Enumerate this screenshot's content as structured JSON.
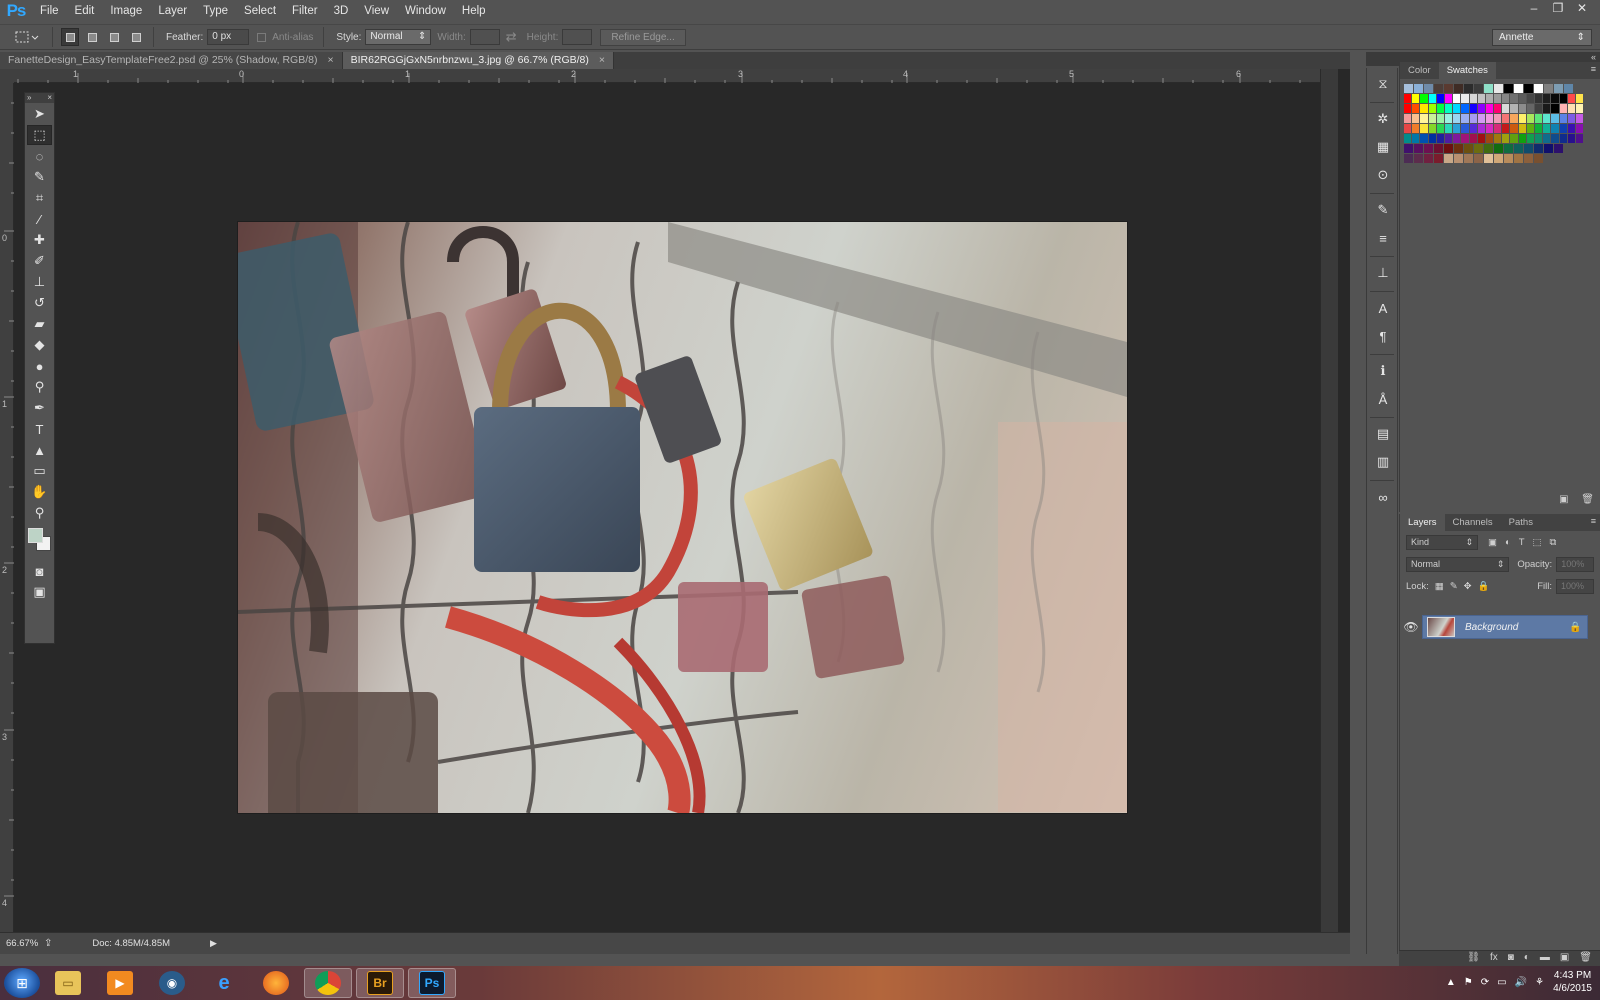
{
  "app": {
    "logo": "Ps"
  },
  "menu": [
    "File",
    "Edit",
    "Image",
    "Layer",
    "Type",
    "Select",
    "Filter",
    "3D",
    "View",
    "Window",
    "Help"
  ],
  "window_controls": {
    "minimize": "–",
    "restore": "❐",
    "close": "✕"
  },
  "options": {
    "feather_label": "Feather:",
    "feather_value": "0 px",
    "antialias_label": "Anti-alias",
    "style_label": "Style:",
    "style_value": "Normal",
    "width_label": "Width:",
    "height_label": "Height:",
    "refine_edge": "Refine Edge...",
    "workspace": "Annette"
  },
  "tabs": [
    {
      "label": "FanetteDesign_EasyTemplateFree2.psd @ 25% (Shadow, RGB/8)",
      "active": false
    },
    {
      "label": "BIR62RGGjGxN5nrbnzwu_3.jpg @ 66.7% (RGB/8)",
      "active": true
    }
  ],
  "ruler": {
    "h_ticks": [
      "0",
      "1",
      "1",
      "2",
      "3",
      "4",
      "5",
      "6"
    ],
    "v_ticks": [
      "0",
      "1",
      "2",
      "3",
      "4"
    ]
  },
  "status": {
    "zoom": "66.67%",
    "doc": "Doc: 4.85M/4.85M"
  },
  "tools": [
    "move-tool-icon",
    "marquee-tool-icon",
    "lasso-tool-icon",
    "quick-selection-tool-icon",
    "crop-tool-icon",
    "eyedropper-tool-icon",
    "healing-brush-tool-icon",
    "brush-tool-icon",
    "clone-stamp-tool-icon",
    "history-brush-tool-icon",
    "eraser-tool-icon",
    "paint-bucket-tool-icon",
    "blur-tool-icon",
    "dodge-tool-icon",
    "pen-tool-icon",
    "type-tool-icon",
    "path-selection-tool-icon",
    "rectangle-tool-icon",
    "hand-tool-icon",
    "zoom-tool-icon"
  ],
  "colors": {
    "foreground": "#bdd3c6",
    "background": "#f2f2f2",
    "accent": "#31a8ff",
    "layer_selected": "#5d79a5"
  },
  "color_panel": {
    "tabs": [
      "Color",
      "Swatches"
    ],
    "active_tab": "Swatches"
  },
  "swatches": [
    [
      "#a6c0dd",
      "#8ab0d8",
      "#6f8ba9",
      "#4c3d38",
      "#5a3a30",
      "#3f2c25",
      "#2c2c2c",
      "#3b3b3b",
      "#8ee0c8",
      "#e8e8e8",
      "#000000",
      "#ffffff",
      "#000000",
      "#ffffff",
      "#808080",
      "#7d9db3",
      "#5f86a8"
    ],
    [
      "#ff0000",
      "#ffff00",
      "#00ff00",
      "#00ffff",
      "#0000ff",
      "#ff00ff",
      "#ffffff",
      "#ebebeb",
      "#d6d6d6",
      "#c2c2c2",
      "#adadad",
      "#999999",
      "#858585",
      "#707070",
      "#5c5c5c",
      "#474747",
      "#333333",
      "#1f1f1f",
      "#0a0a0a",
      "#000000",
      "#ff4b4b",
      "#ffe34b"
    ],
    [
      "#ff0000",
      "#ff4d00",
      "#ffe600",
      "#9dff00",
      "#00ff44",
      "#00ffc3",
      "#00d9ff",
      "#0066ff",
      "#1400ff",
      "#8c00ff",
      "#ff00e1",
      "#ff0070",
      "#d9d9d9",
      "#b3b3b3",
      "#8c8c8c",
      "#666666",
      "#404040",
      "#1a1a1a",
      "#000000",
      "#ffb3b3",
      "#ffe0b3",
      "#fff3b3"
    ],
    [
      "#f59a9a",
      "#f9c08f",
      "#fff59a",
      "#c8f29a",
      "#9af2a6",
      "#9af2e2",
      "#9ad6f2",
      "#9aaef2",
      "#a89af2",
      "#d39af2",
      "#f29ae0",
      "#f29ab8",
      "#f57575",
      "#f7a65c",
      "#fff06a",
      "#a9e65c",
      "#5ce67a",
      "#5ce6cf",
      "#5cbde6",
      "#5c83e6",
      "#7d5ce6",
      "#c45ce6"
    ],
    [
      "#e84646",
      "#ef7c2a",
      "#f9e43a",
      "#84d62a",
      "#2ad654",
      "#2ad6b8",
      "#2aa1d6",
      "#2a5ad6",
      "#552ad6",
      "#a82ad6",
      "#d62ac0",
      "#d62a7a",
      "#c41a1a",
      "#cc5a10",
      "#d1ba10",
      "#5fb010",
      "#10b03a",
      "#10b096",
      "#1082b0",
      "#1040b0",
      "#3a10b0",
      "#8810b0"
    ],
    [
      "#008c8c",
      "#0077a8",
      "#0050b0",
      "#0030a0",
      "#20209c",
      "#501ca0",
      "#80189c",
      "#a01478",
      "#a0104e",
      "#a01010",
      "#a04810",
      "#a07810",
      "#a0a010",
      "#60a010",
      "#10a010",
      "#10a050",
      "#108c6c",
      "#106c8c",
      "#104c8c",
      "#102c8c",
      "#28108c",
      "#50108c"
    ],
    [
      "#40106c",
      "#581060",
      "#6c1050",
      "#6c1030",
      "#6c1010",
      "#6c3010",
      "#6c5010",
      "#6c6c10",
      "#406c10",
      "#106c10",
      "#106c40",
      "#10605c",
      "#104c6c",
      "#102c6c",
      "#10106c",
      "#2c106c"
    ],
    [
      "#4c2c54",
      "#5c2c4c",
      "#702040",
      "#7a1c2c",
      "#c8a888",
      "#b89070",
      "#a07858",
      "#8c6448",
      "#e0c098",
      "#d0a878",
      "#b88c5c",
      "#a07444",
      "#8c603c",
      "#785030"
    ]
  ],
  "layers_panel": {
    "tabs": [
      "Layers",
      "Channels",
      "Paths"
    ],
    "active_tab": "Layers",
    "kind_label": "Kind",
    "blend_mode": "Normal",
    "opacity_label": "Opacity:",
    "opacity_value": "100%",
    "lock_label": "Lock:",
    "fill_label": "Fill:",
    "fill_value": "100%",
    "layers": [
      {
        "name": "Background",
        "visible": true,
        "locked": true
      }
    ]
  },
  "dock_icons": [
    "history-icon",
    "navigator-icon",
    "histogram-icon",
    "info-icon",
    "brush-presets-icon",
    "adjustments-icon",
    "styles-icon",
    "character-icon",
    "paragraph-icon",
    "character-styles-icon",
    "paragraph-styles-icon",
    "properties-icon",
    "notes-icon",
    "creative-cloud-icon"
  ],
  "taskbar": {
    "apps": [
      "windows-explorer-icon",
      "media-player-icon",
      "steam-icon",
      "internet-explorer-icon",
      "firefox-icon",
      "chrome-icon",
      "bridge-icon",
      "photoshop-icon"
    ],
    "bridge_label": "Br",
    "photoshop_label": "Ps",
    "time": "4:43 PM",
    "date": "4/6/2015"
  }
}
